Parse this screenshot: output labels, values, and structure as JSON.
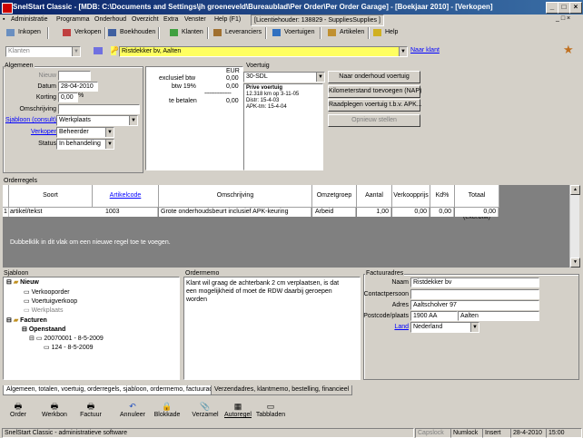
{
  "window": {
    "title": "SnelStart Classic - [MDB: C:\\Documents and Settings\\jh groeneveld\\Bureaublad\\Per Order\\Per Order Garage] - [Boekjaar 2010] - [Verkopen]",
    "menu": [
      "Administratie",
      "Programma",
      "Onderhoud",
      "Overzicht",
      "Extra",
      "Venster",
      "Help (F1)"
    ],
    "license": "[Licentiehouder: 138829 - SuppliesSupplies ]"
  },
  "toolbar": {
    "items": [
      "Inkopen",
      "Verkopen",
      "Boekhouden",
      "Klanten",
      "Leveranciers",
      "Voertuigen",
      "Artikelen",
      "Help"
    ]
  },
  "search": {
    "type_value": "Klanten",
    "search_value": "Ristdekker bv, Aalten",
    "new_customer_link": "Naar klant"
  },
  "algemeen": {
    "title": "Algemeen",
    "nieuw_label": "Nieuw",
    "datum_label": "Datum",
    "datum_value": "28-04-2010",
    "korting_label": "Korting",
    "korting_value": "0,00",
    "korting_unit": "%",
    "omschrijving_label": "Omschrijving",
    "sjabloon_label": "Sjabloon (consult)",
    "sjabloon_value": "Werkplaats",
    "verkoper_label": "Verkoper",
    "verkoper_value": "Beheerder",
    "status_label": "Status",
    "status_value": "In behandeling"
  },
  "totals": {
    "currency": "EUR",
    "rows": [
      {
        "label": "exclusief btw",
        "value": "0,00"
      },
      {
        "label": "btw 19%",
        "value": "0,00"
      },
      {
        "label": "te betalen",
        "value": "0,00"
      }
    ],
    "divider": "----------------"
  },
  "voertuig": {
    "title": "Voertuig",
    "plate_value": "30-SDL",
    "info_lines": [
      "Prive voertuig",
      "12.318 km op 3-11-05",
      "Distr: 15-4-03",
      "APK-tm: 15-4-04"
    ]
  },
  "actions": {
    "buttons": [
      "Naar onderhoud voertuig",
      "Kilometerstand toevoegen (NAP)",
      "Raadplegen voertuig t.b.v. APK..."
    ],
    "disabled_button": "Opnieuw stellen"
  },
  "orderregels": {
    "title": "Orderregels",
    "columns": [
      "Soort",
      "Artikelcode",
      "Omschrijving",
      "Omzetgroep",
      "Aantal",
      "Verkoopprijs",
      "Kd%",
      "Totaal (excl.btw)"
    ],
    "rows": [
      {
        "nr": "1",
        "soort": "artikel/tekst",
        "artikelcode": "1003",
        "omschrijving": "Grote onderhoudsbeurt inclusief APK-keuring",
        "omzetgroep": "Arbeid",
        "aantal": "1,00",
        "verkoopprijs": "0,00",
        "korting": "0,00",
        "totaal": "0,00"
      }
    ],
    "hint": "Dubbelklik in dit vlak om een nieuwe regel toe te voegen."
  },
  "sjabloon_tree": {
    "title": "Sjabloon",
    "nodes": [
      "Nieuw",
      "Verkooporder",
      "Voertuigverkoop",
      "Werkplaats",
      "Facturen",
      "Openstaand",
      "20070001 - 8-5-2009",
      "124 - 8-5-2009"
    ]
  },
  "ordermemo": {
    "title": "Ordermemo",
    "text": "Klant wil graag de achterbank 2 cm verplaatsen, is dat een mogelijkheid of moet de RDW daarbij geroepen worden"
  },
  "factuuradres": {
    "title": "Factuuradres",
    "naam_label": "Naam",
    "naam_value": "Ristdekker bv",
    "contact_label": "Contactpersoon",
    "contact_value": "",
    "adres_label": "Adres",
    "adres_value": "Aaltscholver 97",
    "postcode_label": "Postcode/plaats",
    "postcode_value": "1900 AA",
    "plaats_value": "Aalten",
    "land_label": "Land",
    "land_value": "Nederland"
  },
  "tabs": [
    "Algemeen, totalen, voertuig, orderregels, sjabloon, ordermemo, factuuradres",
    "Verzendadres, klantmemo, bestelling, financieel"
  ],
  "bottom_toolbar": [
    "Order",
    "Werkbon",
    "Factuur",
    "Annuleer",
    "Blokkade",
    "Verzamel",
    "Autoregel",
    "Tabbladen"
  ],
  "statusbar": {
    "app": "SnelStart Classic - administratieve software",
    "capslock": "Capslock",
    "numlock": "Numlock",
    "insert": "Insert",
    "date": "28-4-2010",
    "time": "15:00"
  },
  "colors": {
    "title_start": "#0a246a",
    "title_end": "#3a6ea5",
    "search_highlight": "#ffff60",
    "grid_bg": "#808080"
  }
}
